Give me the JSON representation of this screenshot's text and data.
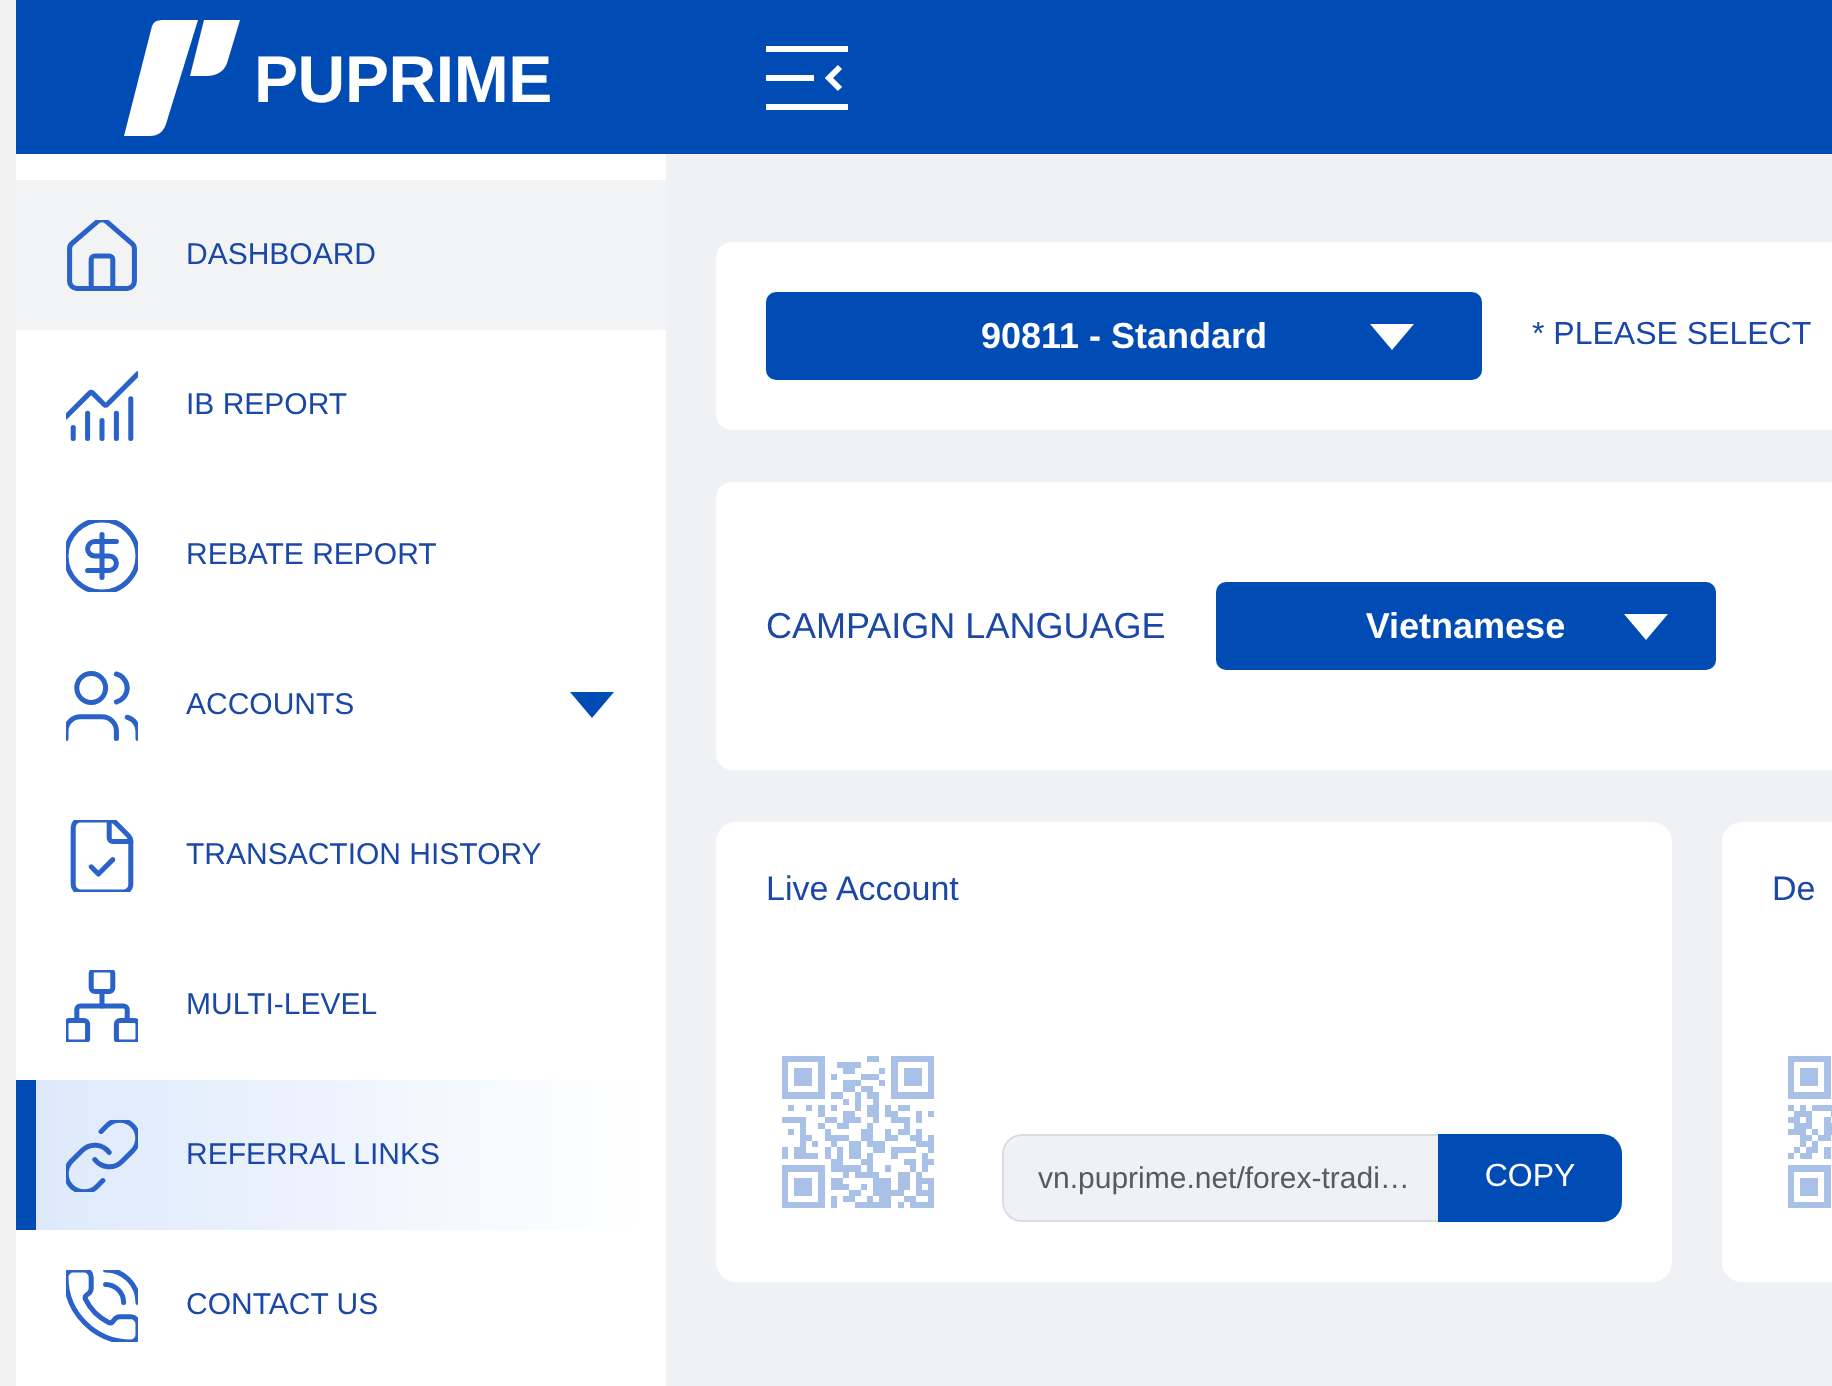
{
  "header": {
    "brand": "PUPRIME"
  },
  "sidebar": {
    "items": [
      {
        "label": "DASHBOARD",
        "kind": "link",
        "selected": false,
        "hovered": true
      },
      {
        "label": "IB REPORT",
        "kind": "link",
        "selected": false,
        "hovered": false
      },
      {
        "label": "REBATE REPORT",
        "kind": "link",
        "selected": false,
        "hovered": false
      },
      {
        "label": "ACCOUNTS",
        "kind": "group",
        "expanded": false,
        "selected": false,
        "hovered": false
      },
      {
        "label": "TRANSACTION HISTORY",
        "kind": "link",
        "selected": false,
        "hovered": false
      },
      {
        "label": "MULTI-LEVEL",
        "kind": "link",
        "selected": false,
        "hovered": false
      },
      {
        "label": "REFERRAL LINKS",
        "kind": "link",
        "selected": true,
        "hovered": false
      },
      {
        "label": "CONTACT US",
        "kind": "link",
        "selected": false,
        "hovered": false
      }
    ]
  },
  "account_bar": {
    "account_select": "90811 - Standard",
    "prompt": "* PLEASE SELECT"
  },
  "language_bar": {
    "label": "CAMPAIGN LANGUAGE",
    "language_select": "Vietnamese"
  },
  "link_cards": [
    {
      "title": "Live Account",
      "link": "vn.puprime.net/forex-tradi…",
      "button": "COPY"
    },
    {
      "title": "De"
    }
  ]
}
